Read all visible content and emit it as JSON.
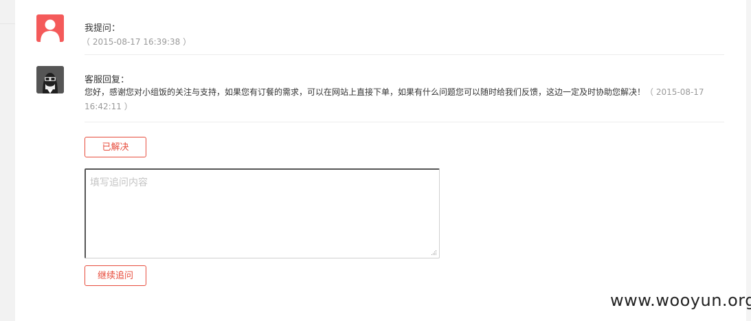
{
  "thread": {
    "question": {
      "avatar_icon": "user-avatar-icon",
      "label": "我提问：",
      "time": "（ 2015-08-17 16:39:38 ）"
    },
    "reply": {
      "avatar_icon": "service-agent-avatar-icon",
      "label": "客服回复：",
      "text": "您好，感谢您对小组饭的关注与支持，如果您有订餐的需求，可以在网站上直接下单，如果有什么问题您可以随时给我们反馈，这边一定及时协助您解决！",
      "time": "（ 2015-08-17 16:42:11 ）"
    }
  },
  "actions": {
    "resolved_label": "已解决",
    "followup_placeholder": "填写追问内容",
    "followup_value": "",
    "continue_label": "继续追问"
  },
  "watermark": "www.wooyun.org",
  "colors": {
    "accent": "#e74c3c",
    "user_avatar": "#f45a5a",
    "agent_avatar": "#5a5a5a"
  }
}
